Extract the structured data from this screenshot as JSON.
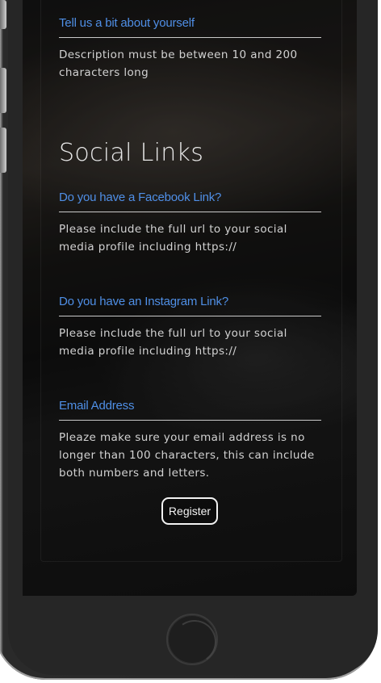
{
  "form": {
    "about": {
      "label": "Tell us a bit about yourself",
      "help": "Description must be between 10 and 200 characters long"
    },
    "social_title": "Social Links",
    "facebook": {
      "label": "Do you have a Facebook Link?",
      "help": "Please include the full url to your social media profile including https://"
    },
    "instagram": {
      "label": "Do you have an Instagram Link?",
      "help": "Please include the full url to your social media profile including https://"
    },
    "email": {
      "label": "Email Address",
      "help": "Pleaze make sure your email address is no longer than 100 characters, this can include both numbers and letters."
    },
    "register_label": "Register"
  },
  "colors": {
    "label_blue": "#4f8fe6",
    "phone_dark": "#262626"
  },
  "icons": {
    "home_button": "home-button-icon"
  }
}
